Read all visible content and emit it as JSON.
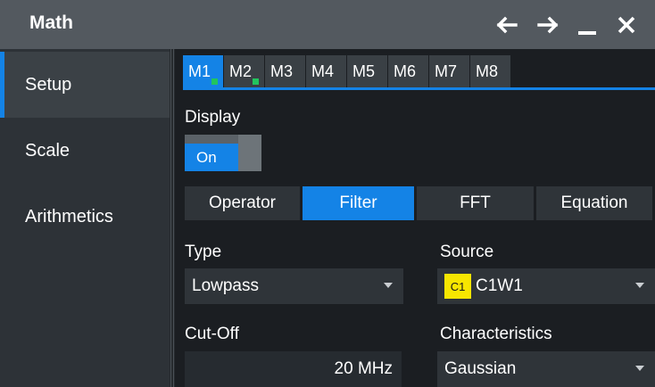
{
  "window": {
    "title": "Math",
    "controls": [
      "back-arrow-icon",
      "forward-arrow-icon",
      "minimize-icon",
      "close-icon"
    ]
  },
  "sidebar": {
    "items": [
      {
        "label": "Setup",
        "active": true
      },
      {
        "label": "Scale",
        "active": false
      },
      {
        "label": "Arithmetics",
        "active": false
      }
    ]
  },
  "math_tabs": [
    {
      "label": "M1",
      "active": true,
      "enabled": true
    },
    {
      "label": "M2",
      "active": false,
      "enabled": true
    },
    {
      "label": "M3",
      "active": false,
      "enabled": false
    },
    {
      "label": "M4",
      "active": false,
      "enabled": false
    },
    {
      "label": "M5",
      "active": false,
      "enabled": false
    },
    {
      "label": "M6",
      "active": false,
      "enabled": false
    },
    {
      "label": "M7",
      "active": false,
      "enabled": false
    },
    {
      "label": "M8",
      "active": false,
      "enabled": false
    }
  ],
  "display": {
    "label": "Display",
    "toggle_label": "On",
    "state": true
  },
  "mode_tabs": [
    {
      "label": "Operator",
      "active": false
    },
    {
      "label": "Filter",
      "active": true
    },
    {
      "label": "FFT",
      "active": false
    },
    {
      "label": "Equation",
      "active": false
    }
  ],
  "type": {
    "label": "Type",
    "value": "Lowpass"
  },
  "source": {
    "label": "Source",
    "badge": "C1",
    "value": "C1W1"
  },
  "cutoff": {
    "label": "Cut-Off",
    "value": "20 MHz"
  },
  "characteristics": {
    "label": "Characteristics",
    "value": "Gaussian"
  },
  "colors": {
    "accent": "#1483e6",
    "enabled_indicator": "#22c55e",
    "channel_badge": "#f7e600",
    "titlebar": "#53595f"
  }
}
